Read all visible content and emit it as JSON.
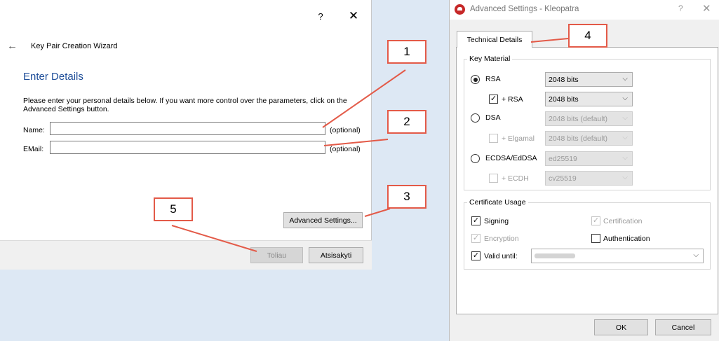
{
  "wizard": {
    "help_glyph": "?",
    "close_glyph": "✕",
    "back_glyph": "←",
    "title": "Key Pair Creation Wizard",
    "heading": "Enter Details",
    "intro": "Please enter your personal details below. If you want more control over the parameters, click on the Advanced Settings button.",
    "name_label": "Name:",
    "name_value": "",
    "email_label": "EMail:",
    "email_value": "",
    "optional_label": "(optional)",
    "advanced_button": "Advanced Settings...",
    "next_button": "Toliau",
    "cancel_button": "Atsisakyti"
  },
  "advanced": {
    "window_title": "Advanced Settings - Kleopatra",
    "help_glyph": "?",
    "close_glyph": "✕",
    "tab_label": "Technical Details",
    "key_material": {
      "title": "Key Material",
      "rsa": {
        "label": "RSA",
        "checked": true,
        "bits": "2048 bits"
      },
      "rsa_sub": {
        "label": "+ RSA",
        "checked": true,
        "bits": "2048 bits"
      },
      "dsa": {
        "label": "DSA",
        "checked": false,
        "bits": "2048 bits (default)"
      },
      "dsa_sub": {
        "label": "+ Elgamal",
        "checked": false,
        "bits": "2048 bits (default)"
      },
      "ecdsa": {
        "label": "ECDSA/EdDSA",
        "checked": false,
        "curve": "ed25519"
      },
      "ecdsa_sub": {
        "label": "+ ECDH",
        "checked": false,
        "curve": "cv25519"
      }
    },
    "certificate_usage": {
      "title": "Certificate Usage",
      "signing": "Signing",
      "certification": "Certification",
      "encryption": "Encryption",
      "authentication": "Authentication",
      "valid_until": "Valid until:"
    },
    "ok_button": "OK",
    "cancel_button": "Cancel",
    "check_glyph": "✓",
    "arrow_glyph": "⌵"
  },
  "callouts": [
    "1",
    "2",
    "3",
    "4",
    "5"
  ],
  "colors": {
    "accent_heading": "#1f4e99",
    "callout_border": "#e35a48",
    "app_icon": "#c62828"
  }
}
